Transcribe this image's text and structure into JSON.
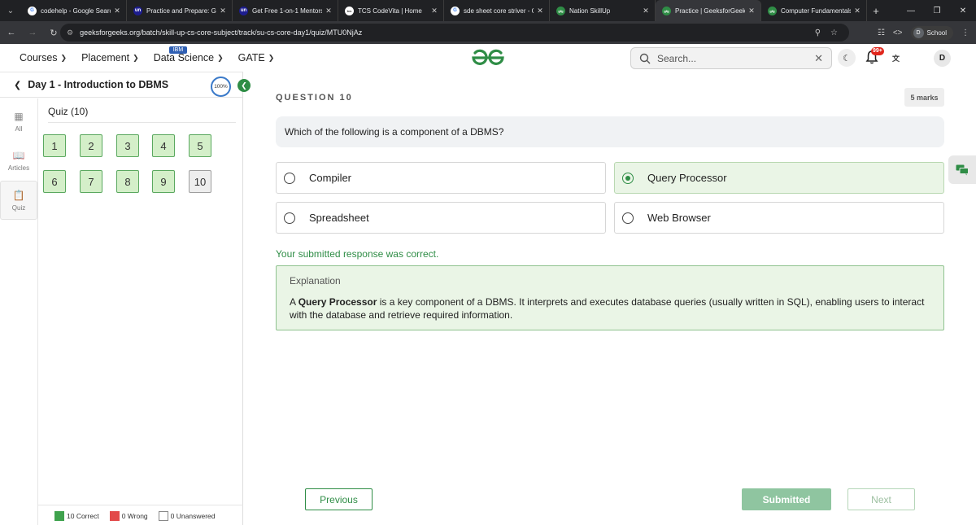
{
  "browser": {
    "tabs": [
      {
        "title": "codehelp - Google Search",
        "favicon": "G",
        "color": "#ffffff",
        "text": "#4285f4"
      },
      {
        "title": "Practice and Prepare: Get",
        "favicon": "un",
        "color": "#1d1d8f",
        "text": "#ffffff"
      },
      {
        "title": "Get Free 1-on-1 Mentorsh",
        "favicon": "un",
        "color": "#1d1d8f",
        "text": "#ffffff"
      },
      {
        "title": "TCS CodeVita | Home",
        "favicon": "tcs",
        "color": "#ffffff",
        "text": "#333333"
      },
      {
        "title": "sde sheet core striver - G",
        "favicon": "G",
        "color": "#ffffff",
        "text": "#4285f4"
      },
      {
        "title": "Nation SkillUp",
        "favicon": "gfg",
        "color": "#2f8d46",
        "text": "#ffffff"
      },
      {
        "title": "Practice | GeeksforGeeks",
        "favicon": "gfg",
        "color": "#2f8d46",
        "text": "#ffffff",
        "active": true
      },
      {
        "title": "Computer Fundamentals",
        "favicon": "gfg",
        "color": "#2f8d46",
        "text": "#ffffff"
      }
    ],
    "url": "geeksforgeeks.org/batch/skill-up-cs-core-subject/track/su-cs-core-day1/quiz/MTU0NjAz",
    "profile_label": "School",
    "profile_initial": "D"
  },
  "header": {
    "nav": [
      {
        "label": "Courses"
      },
      {
        "label": "Placement"
      },
      {
        "label": "Data Science",
        "badge": "IBM"
      },
      {
        "label": "GATE"
      }
    ],
    "search_placeholder": "Search...",
    "notification_count": "99+",
    "user_initial": "D",
    "brand_color": "#2f8d46"
  },
  "sidebar": {
    "title": "Day 1 - Introduction to DBMS",
    "progress": "100%",
    "rail": [
      {
        "label": "All",
        "icon": "grid-icon"
      },
      {
        "label": "Articles",
        "icon": "book-icon"
      },
      {
        "label": "Quiz",
        "icon": "clipboard-icon",
        "active": true
      }
    ],
    "quiz_title": "Quiz (10)",
    "questions": [
      "1",
      "2",
      "3",
      "4",
      "5",
      "6",
      "7",
      "8",
      "9",
      "10"
    ],
    "current_question": "10",
    "legend": {
      "correct": "10 Correct",
      "wrong": "0 Wrong",
      "unanswered": "0 Unanswered"
    }
  },
  "question": {
    "label": "QUESTION 10",
    "marks": "5 marks",
    "text": "Which of the following is a component of a DBMS?",
    "options": [
      {
        "label": "Compiler",
        "selected": false
      },
      {
        "label": "Query Processor",
        "selected": true
      },
      {
        "label": "Spreadsheet",
        "selected": false
      },
      {
        "label": "Web Browser",
        "selected": false
      }
    ],
    "result": "Your submitted response was correct.",
    "explanation_title": "Explanation",
    "explanation_prefix": "A ",
    "explanation_bold": "Query Processor",
    "explanation_rest": " is a key component of a DBMS. It interprets and executes database queries (usually written in SQL), enabling users to interact with the database and retrieve required information."
  },
  "buttons": {
    "previous": "Previous",
    "submitted": "Submitted",
    "next": "Next"
  }
}
